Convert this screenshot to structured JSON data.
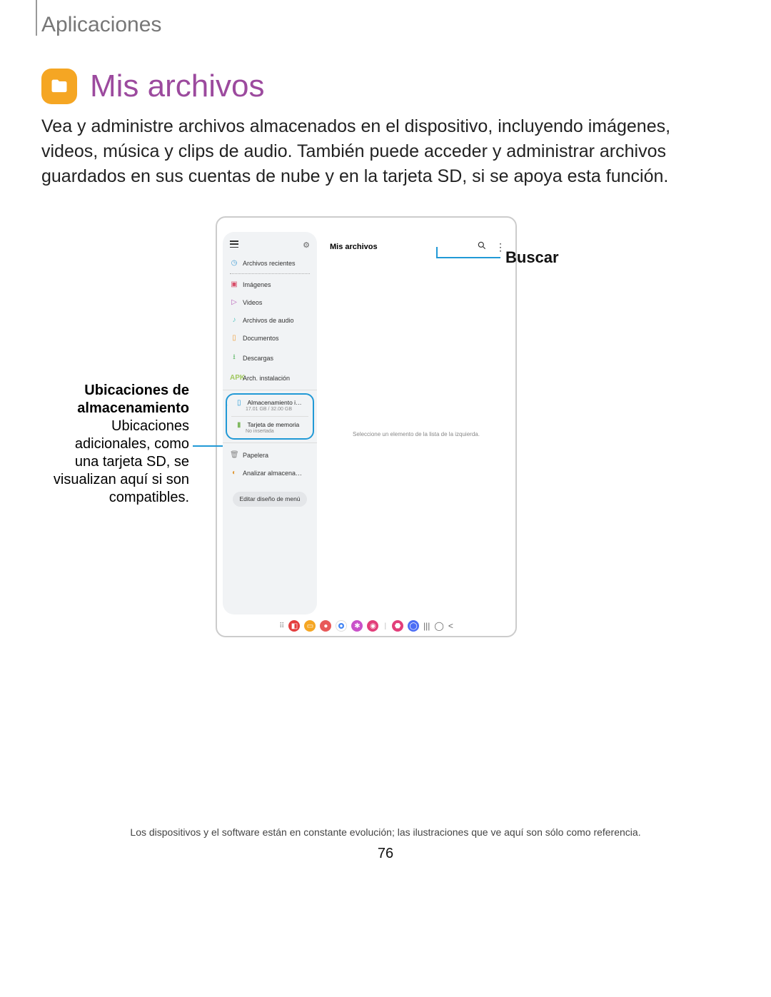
{
  "header": {
    "section": "Aplicaciones"
  },
  "title": "Mis archivos",
  "description": "Vea y administre archivos almacenados en el dispositivo, incluyendo imágenes, videos, música y clips de audio. También puede acceder y administrar archivos guardados en sus cuentas de nube y en la tarjeta SD, si se apoya esta función.",
  "callouts": {
    "left_title": "Ubicaciones de almacenamiento",
    "left_body": "Ubicaciones adicionales, como una tarjeta SD, se visualizan aquí si son compatibles.",
    "right": "Buscar"
  },
  "phone": {
    "main_title": "Mis archivos",
    "main_hint": "Seleccione un elemento de la lista de la izquierda.",
    "sidebar": {
      "recent": "Archivos recientes",
      "images": "Imágenes",
      "videos": "Videos",
      "audio": "Archivos de audio",
      "docs": "Documentos",
      "downloads": "Descargas",
      "apk": "Arch. instalación",
      "internal_title": "Almacenamiento i…",
      "internal_sub": "17.01 GB / 32.00 GB",
      "sd_title": "Tarjeta de memoria",
      "sd_sub": "No insertada",
      "trash": "Papelera",
      "analyze": "Analizar almacena…",
      "edit": "Editar diseño de menú"
    }
  },
  "footer": "Los dispositivos y el software están en constante evolución; las ilustraciones que ve aquí son sólo como referencia.",
  "page": "76"
}
